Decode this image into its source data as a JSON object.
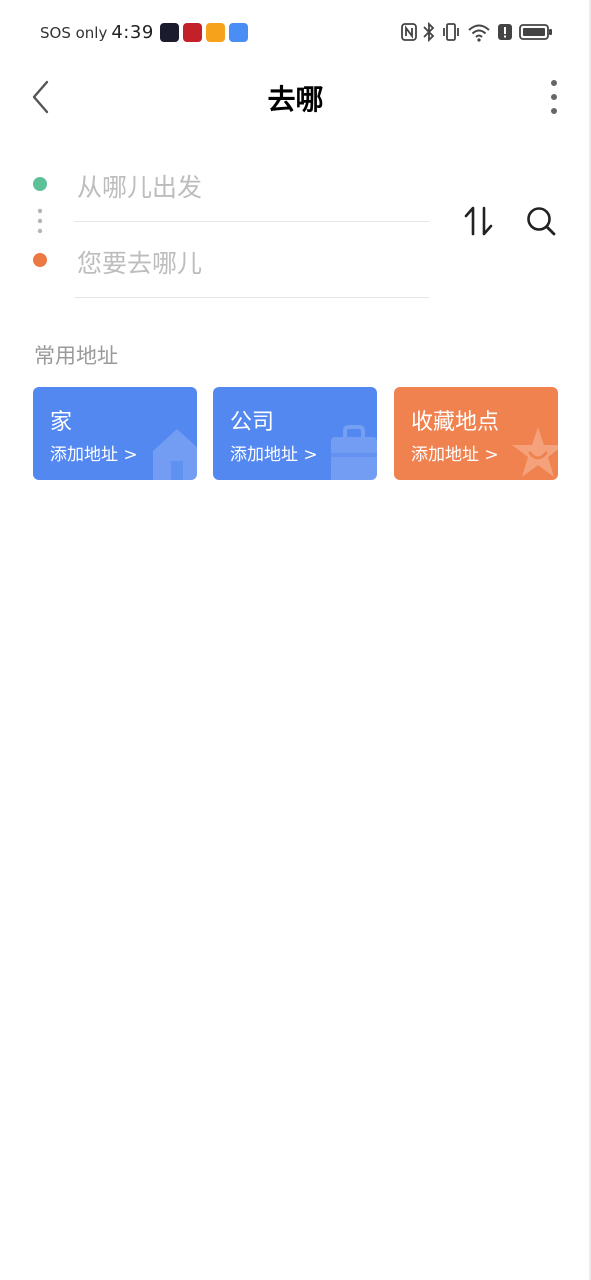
{
  "status_bar": {
    "carrier": "SOS only",
    "time": "4:39",
    "app_colors": [
      "#1b1b2e",
      "#c3202a",
      "#f6a21a",
      "#4a8df5"
    ],
    "icons": [
      "nfc-icon",
      "bluetooth-icon",
      "vibrate-icon",
      "wifi-icon",
      "alert-icon",
      "battery-icon"
    ]
  },
  "nav": {
    "title": "去哪"
  },
  "route": {
    "start_placeholder": "从哪儿出发",
    "end_placeholder": "您要去哪儿",
    "start_color": "#5cc197",
    "end_color": "#ec7844"
  },
  "common": {
    "section_title": "常用地址",
    "cards": [
      {
        "title": "家",
        "subtitle": "添加地址 >",
        "color": "#5388f0",
        "icon": "house-icon"
      },
      {
        "title": "公司",
        "subtitle": "添加地址 >",
        "color": "#5388f0",
        "icon": "briefcase-icon"
      },
      {
        "title": "收藏地点",
        "subtitle": "添加地址 >",
        "color": "#f08250",
        "icon": "star-icon"
      }
    ]
  }
}
